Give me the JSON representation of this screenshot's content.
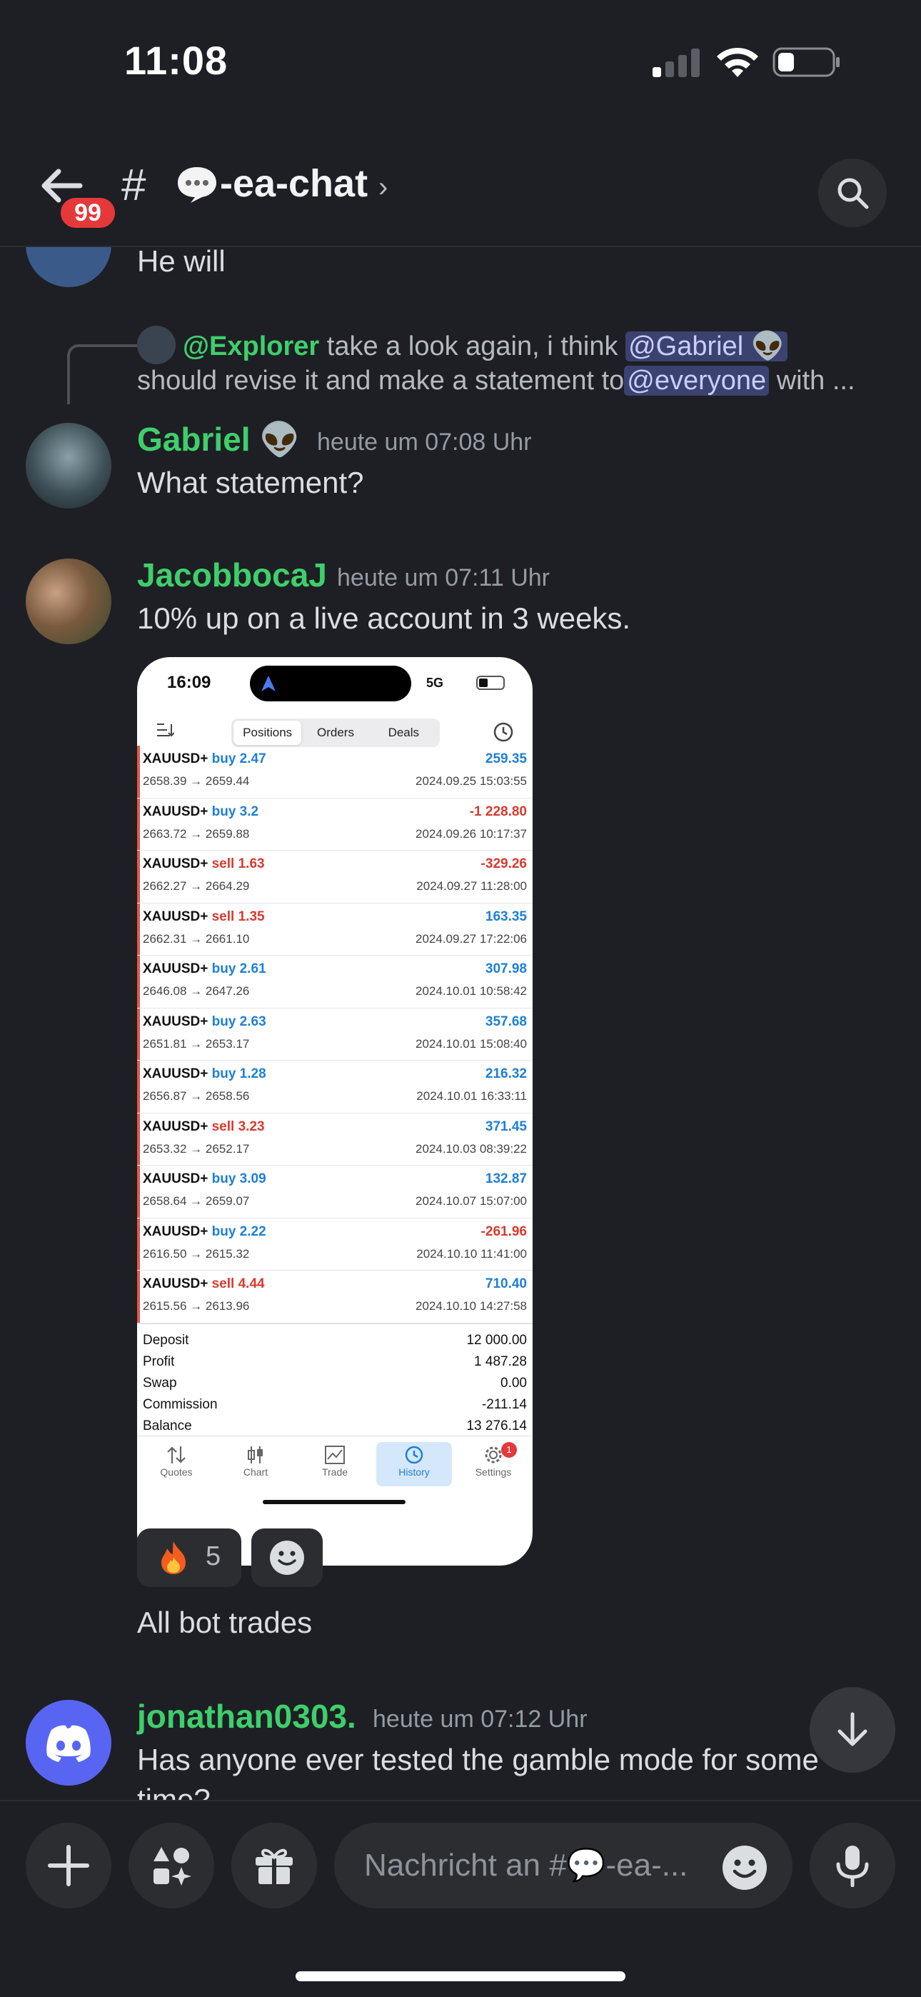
{
  "status_bar": {
    "time": "11:08"
  },
  "header": {
    "unread_badge": "99",
    "hash": "#",
    "channel_name": "-ea-chat",
    "chevron": "›"
  },
  "messages": {
    "prev_text": "He will",
    "reply": {
      "author": "@Explorer",
      "text_part1": "take a look again, i think",
      "mention1": "@Gabriel 👽",
      "text_part2": "should revise it and make a statement to",
      "mention2": "@everyone",
      "text_part3": "with ..."
    },
    "gabriel": {
      "author": "Gabriel 👽",
      "timestamp": "heute um 07:08 Uhr",
      "text": "What statement?"
    },
    "jacob": {
      "author": "JacobbocaJ",
      "timestamp": "heute um 07:11 Uhr",
      "text": "10% up on a live account in 3 weeks.",
      "reaction_emoji": "🔥",
      "reaction_count": "5",
      "followup": "All bot trades"
    },
    "jonathan": {
      "author": "jonathan0303.",
      "timestamp": "heute um 07:12 Uhr",
      "text": "Has anyone ever tested the gamble mode for some",
      "text2": "time?"
    }
  },
  "screenshot": {
    "time": "16:09",
    "network": "5G",
    "tabs": [
      "Positions",
      "Orders",
      "Deals"
    ],
    "active_tab": "Positions",
    "trades": [
      {
        "symbol": "XAUUSD+",
        "side": "buy",
        "volume": "2.47",
        "prices": "2658.39 → 2659.44",
        "profit": "259.35",
        "profit_color": "buy",
        "date": "2024.09.25 15:03:55",
        "bar": "sell"
      },
      {
        "symbol": "XAUUSD+",
        "side": "buy",
        "volume": "3.2",
        "prices": "2663.72 → 2659.88",
        "profit": "-1 228.80",
        "profit_color": "sell",
        "date": "2024.09.26 10:17:37",
        "bar": "buy"
      },
      {
        "symbol": "XAUUSD+",
        "side": "sell",
        "volume": "1.63",
        "prices": "2662.27 → 2664.29",
        "profit": "-329.26",
        "profit_color": "sell",
        "date": "2024.09.27 11:28:00",
        "bar": "buy"
      },
      {
        "symbol": "XAUUSD+",
        "side": "sell",
        "volume": "1.35",
        "prices": "2662.31 → 2661.10",
        "profit": "163.35",
        "profit_color": "buy",
        "date": "2024.09.27 17:22:06",
        "bar": "sell"
      },
      {
        "symbol": "XAUUSD+",
        "side": "buy",
        "volume": "2.61",
        "prices": "2646.08 → 2647.26",
        "profit": "307.98",
        "profit_color": "buy",
        "date": "2024.10.01 10:58:42",
        "bar": "sell"
      },
      {
        "symbol": "XAUUSD+",
        "side": "buy",
        "volume": "2.63",
        "prices": "2651.81 → 2653.17",
        "profit": "357.68",
        "profit_color": "buy",
        "date": "2024.10.01 15:08:40",
        "bar": "sell"
      },
      {
        "symbol": "XAUUSD+",
        "side": "buy",
        "volume": "1.28",
        "prices": "2656.87 → 2658.56",
        "profit": "216.32",
        "profit_color": "buy",
        "date": "2024.10.01 16:33:11",
        "bar": "sell"
      },
      {
        "symbol": "XAUUSD+",
        "side": "sell",
        "volume": "3.23",
        "prices": "2653.32 → 2652.17",
        "profit": "371.45",
        "profit_color": "buy",
        "date": "2024.10.03 08:39:22",
        "bar": "sell"
      },
      {
        "symbol": "XAUUSD+",
        "side": "buy",
        "volume": "3.09",
        "prices": "2658.64 → 2659.07",
        "profit": "132.87",
        "profit_color": "buy",
        "date": "2024.10.07 15:07:00",
        "bar": "sell"
      },
      {
        "symbol": "XAUUSD+",
        "side": "buy",
        "volume": "2.22",
        "prices": "2616.50 → 2615.32",
        "profit": "-261.96",
        "profit_color": "sell",
        "date": "2024.10.10 11:41:00",
        "bar": "buy"
      },
      {
        "symbol": "XAUUSD+",
        "side": "sell",
        "volume": "4.44",
        "prices": "2615.56 → 2613.96",
        "profit": "710.40",
        "profit_color": "buy",
        "date": "2024.10.10 14:27:58",
        "bar": "sell"
      }
    ],
    "summary": [
      {
        "label": "Deposit",
        "value": "12 000.00"
      },
      {
        "label": "Profit",
        "value": "1 487.28"
      },
      {
        "label": "Swap",
        "value": "0.00"
      },
      {
        "label": "Commission",
        "value": "-211.14"
      },
      {
        "label": "Balance",
        "value": "13 276.14"
      }
    ],
    "nav": [
      {
        "label": "Quotes",
        "icon": "quotes-icon"
      },
      {
        "label": "Chart",
        "icon": "candles-icon"
      },
      {
        "label": "Trade",
        "icon": "trade-chart-icon"
      },
      {
        "label": "History",
        "icon": "history-clock-icon"
      },
      {
        "label": "Settings",
        "icon": "settings-gear-icon"
      }
    ],
    "active_nav": "History",
    "settings_badge": "1"
  },
  "composer": {
    "placeholder": "Nachricht an #💬-ea-..."
  },
  "colors": {
    "background": "#1e1f24",
    "author_green": "#3ecf6c",
    "mention_bg": "#3c4270",
    "badge_red": "#e5383b",
    "buy_blue": "#1e7fd6",
    "sell_red": "#d83a2e"
  }
}
